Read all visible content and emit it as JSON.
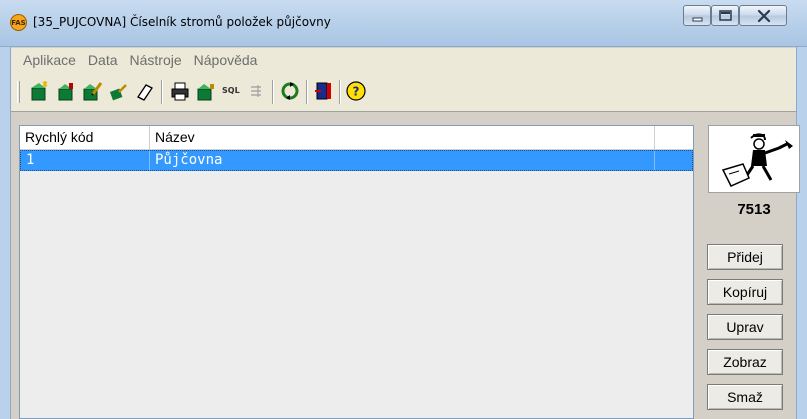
{
  "window": {
    "app_icon_text": "FAS",
    "title": "[35_PUJCOVNA] Číselník stromů položek půjčovny",
    "controls": [
      "minimize-icon",
      "maximize-icon",
      "close-icon"
    ]
  },
  "menu": {
    "items": [
      {
        "label": "Aplikace"
      },
      {
        "label": "Data"
      },
      {
        "label": "Nástroje"
      },
      {
        "label": "Nápověda"
      }
    ]
  },
  "toolbar": {
    "icons": [
      "new-icon",
      "insert-icon",
      "edit-icon",
      "copy-icon",
      "eraser-icon",
      "print-icon",
      "export-icon",
      "sql-icon",
      "filter-icon",
      "refresh-icon",
      "exit-icon",
      "help-icon"
    ],
    "sql_label": "SQL"
  },
  "grid": {
    "columns": [
      "Rychlý kód",
      "Název"
    ],
    "rows": [
      {
        "code": "1",
        "name": "Půjčovna",
        "selected": true
      }
    ],
    "selection_color": "#3399ff"
  },
  "side": {
    "logo": "worker-mascot-icon",
    "number": "7513",
    "buttons": [
      "Přidej",
      "Kopíruj",
      "Uprav",
      "Zobraz",
      "Smaž"
    ]
  }
}
